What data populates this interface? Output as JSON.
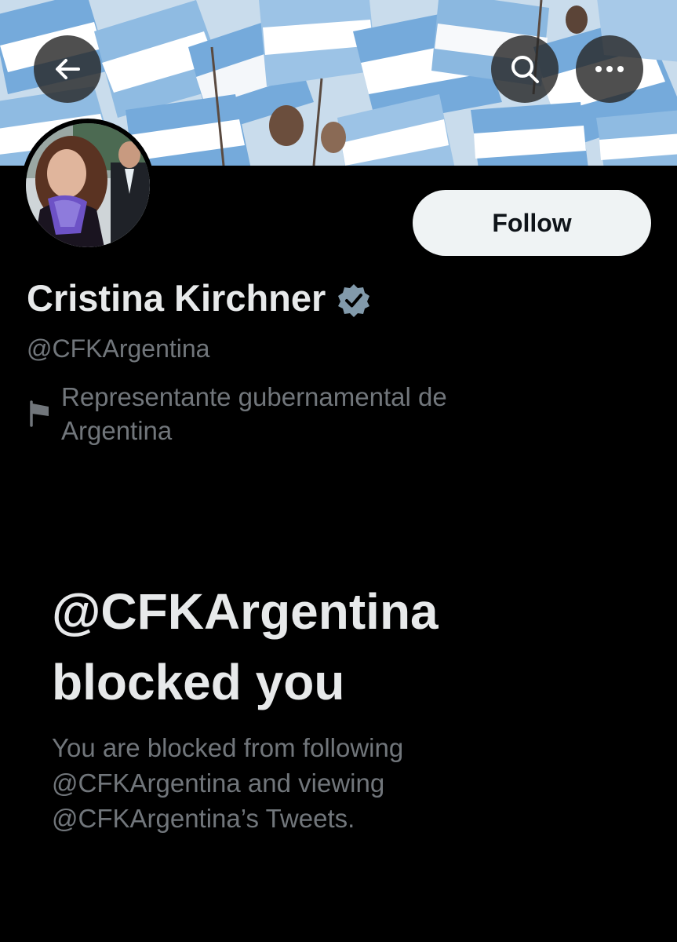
{
  "header": {
    "back_icon": "arrow-left-icon",
    "search_icon": "search-icon",
    "more_icon": "more-horizontal-icon",
    "banner_colors": {
      "flag_blue": "#75aadb",
      "flag_white": "#ffffff"
    }
  },
  "profile": {
    "display_name": "Cristina Kirchner",
    "verified_icon": "verified-badge-icon",
    "verified_color": "#829aab",
    "handle": "@CFKArgentina",
    "affiliation_icon": "flag-icon",
    "affiliation": "Representante gubernamental de Argentina",
    "follow_label": "Follow"
  },
  "blocked": {
    "title": "@CFKArgentina blocked you",
    "description": "You are blocked from following @CFKArgentina and viewing @CFKArgentina’s Tweets."
  }
}
